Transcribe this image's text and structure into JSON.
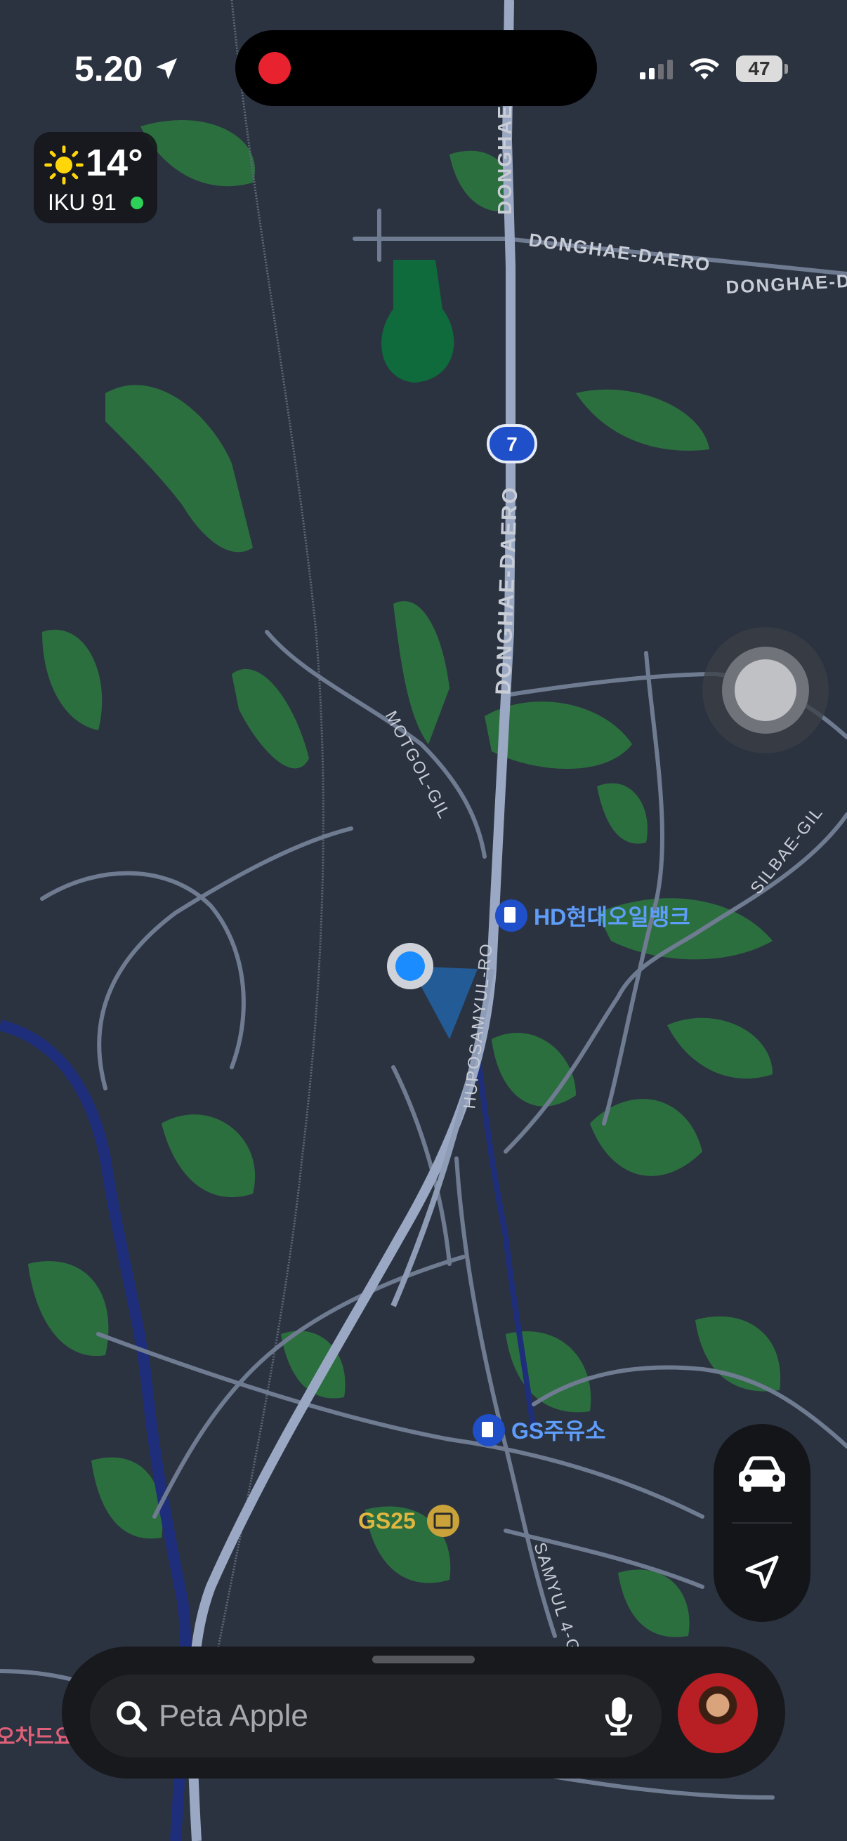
{
  "status_bar": {
    "time": "5.20",
    "battery_level": "47",
    "location_active": true,
    "recording_indicator_color": "#e8232f"
  },
  "weather_widget": {
    "icon": "sun-icon",
    "temperature": "14°",
    "air_quality": "IKU 91",
    "air_quality_status_color": "#2ed158"
  },
  "map": {
    "road_labels": [
      "DONGHAE",
      "DONGHAE-DAERO",
      "DONGHAE-DA",
      "DONGHAE-DAERO",
      "MOTGOL-GIL",
      "HUPOSAMYUL-RO",
      "SILBAE-GIL",
      "SAMYUL 4-G"
    ],
    "route_shield": "7",
    "places": [
      {
        "name": "HD현대오일뱅크",
        "icon": "fuel-icon"
      },
      {
        "name": "GS주유소",
        "icon": "fuel-icon"
      },
      {
        "name": "GS25",
        "icon": "store-icon"
      }
    ],
    "edge_label": "오차드요"
  },
  "controls": {
    "transport_mode_icon": "car-icon",
    "tracking_icon": "location-arrow-icon"
  },
  "search": {
    "placeholder": "Peta Apple",
    "mic_icon": "microphone-icon"
  },
  "colors": {
    "map_background": "#2b3340",
    "vegetation": "#2d7a3f",
    "road": "#6f7b91",
    "highway": "#9aa8c4",
    "water": "#1e2e7a",
    "user_location": "#1a8cff",
    "poi_blue": "#5f9dfa",
    "poi_yellow": "#e0b640"
  }
}
